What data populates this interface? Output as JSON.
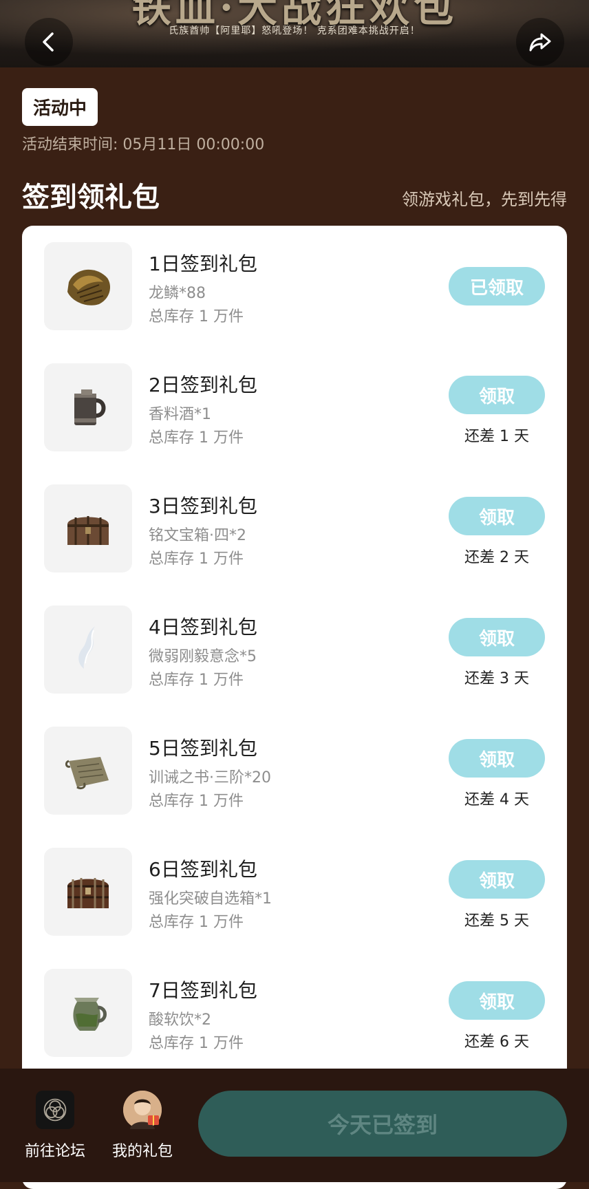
{
  "banner": {
    "title": "铁血·大战狂欢包",
    "subtitle": "氏族酋帅【阿里耶】怒吼登场！ 克系团难本挑战开启！"
  },
  "status_badge": "活动中",
  "end_time": "活动结束时间: 05月11日 00:00:00",
  "section": {
    "title": "签到领礼包",
    "hint": "领游戏礼包，先到先得"
  },
  "items": [
    {
      "title": "1日签到礼包",
      "reward": "龙鳞*88",
      "stock": "总库存 1 万件",
      "button": "已领取",
      "remaining": "",
      "icon": "dragon-scale-icon"
    },
    {
      "title": "2日签到礼包",
      "reward": "香料酒*1",
      "stock": "总库存 1 万件",
      "button": "领取",
      "remaining": "还差 1 天",
      "icon": "tankard-icon"
    },
    {
      "title": "3日签到礼包",
      "reward": "铭文宝箱·四*2",
      "stock": "总库存 1 万件",
      "button": "领取",
      "remaining": "还差 2 天",
      "icon": "treasure-chest-icon"
    },
    {
      "title": "4日签到礼包",
      "reward": "微弱刚毅意念*5",
      "stock": "总库存 1 万件",
      "button": "领取",
      "remaining": "还差 3 天",
      "icon": "wisp-icon"
    },
    {
      "title": "5日签到礼包",
      "reward": "训诫之书·三阶*20",
      "stock": "总库存 1 万件",
      "button": "领取",
      "remaining": "还差 4 天",
      "icon": "scroll-icon"
    },
    {
      "title": "6日签到礼包",
      "reward": "强化突破自选箱*1",
      "stock": "总库存 1 万件",
      "button": "领取",
      "remaining": "还差 5 天",
      "icon": "chest-icon"
    },
    {
      "title": "7日签到礼包",
      "reward": "酸软饮*2",
      "stock": "总库存 1 万件",
      "button": "领取",
      "remaining": "还差 6 天",
      "icon": "pitcher-icon"
    }
  ],
  "bottom": {
    "forum_label": "前往论坛",
    "gift_label": "我的礼包",
    "signin_label": "今天已签到"
  },
  "colors": {
    "page_bg": "#3a2014",
    "button_teal": "#9fdde6",
    "signin_bg": "#2f5d58",
    "bottom_bar": "#2a1710"
  }
}
